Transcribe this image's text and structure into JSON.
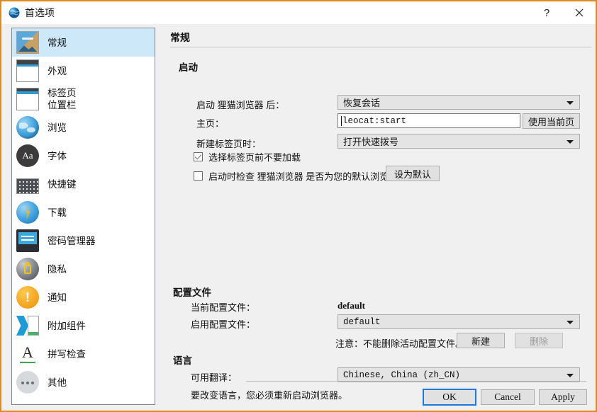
{
  "window": {
    "title": "首选项",
    "icon": "globe-icon",
    "border_color": "#e08a1e",
    "help_label": "?",
    "close_label": "✕"
  },
  "sidebar": {
    "items": [
      {
        "label": "常规",
        "icon": "picture-icon",
        "selected": true
      },
      {
        "label": "外观",
        "icon": "window-icon",
        "selected": false
      },
      {
        "label": "标签页\n位置栏",
        "icon": "tabs-window-icon",
        "selected": false
      },
      {
        "label": "浏览",
        "icon": "globe-icon",
        "selected": false
      },
      {
        "label": "字体",
        "icon": "font-aa-icon",
        "selected": false
      },
      {
        "label": "快捷键",
        "icon": "keyboard-icon",
        "selected": false
      },
      {
        "label": "下载",
        "icon": "download-globe-icon",
        "selected": false
      },
      {
        "label": "密码管理器",
        "icon": "password-monitor-icon",
        "selected": false
      },
      {
        "label": "隐私",
        "icon": "privacy-lock-icon",
        "selected": false
      },
      {
        "label": "通知",
        "icon": "notification-bang-icon",
        "selected": false
      },
      {
        "label": "附加组件",
        "icon": "addons-puzzle-icon",
        "selected": false
      },
      {
        "label": "拼写检查",
        "icon": "spellcheck-a-icon",
        "selected": false
      },
      {
        "label": "其他",
        "icon": "ellipsis-icon",
        "selected": false
      }
    ]
  },
  "main": {
    "page_title": "常规",
    "startup": {
      "group_title": "启动",
      "on_startup_label": "启动 狸猫浏览器 后：",
      "on_startup_value": "恢复会话",
      "homepage_label": "主页：",
      "homepage_value": "leocat:start",
      "use_current_page_button": "使用当前页",
      "new_tab_label": "新建标签页时：",
      "new_tab_value": "打开快速拨号",
      "checkbox_defer_load": "选择标签页前不要加载",
      "checkbox_defer_load_checked": true,
      "checkbox_default_browser": "启动时检查 狸猫浏览器 是否为您的默认浏览器",
      "checkbox_default_browser_checked": false,
      "set_default_button": "设为默认"
    },
    "profiles": {
      "group_title": "配置文件",
      "current_profile_label": "当前配置文件：",
      "current_profile_value": "default",
      "active_profile_label": "启用配置文件：",
      "active_profile_value": "default",
      "note": "注意：不能删除活动配置文件。",
      "new_button": "新建",
      "delete_button": "删除",
      "delete_disabled": true
    },
    "language": {
      "group_title": "语言",
      "available_translations_label": "可用翻译：",
      "available_translations_value": "Chinese, China (zh_CN)",
      "restart_note": "要改变语言，您必须重新启动浏览器。"
    }
  },
  "footer": {
    "ok": "OK",
    "cancel": "Cancel",
    "apply": "Apply",
    "focus_color": "#1e7ad6"
  }
}
